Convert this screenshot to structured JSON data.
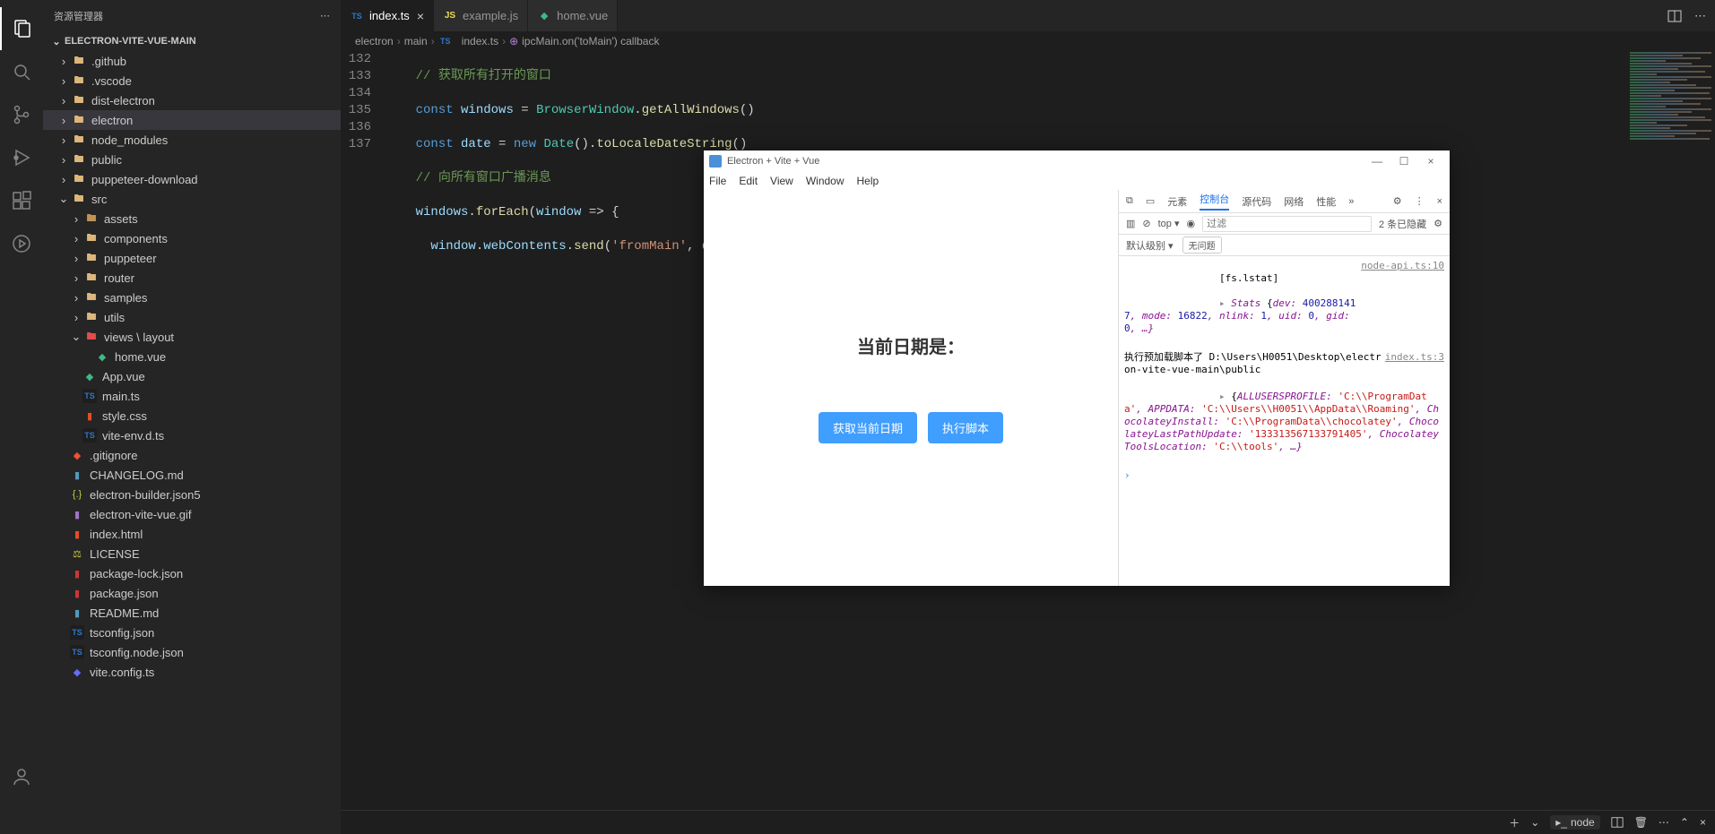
{
  "sidebar": {
    "title": "资源管理器",
    "project": "ELECTRON-VITE-VUE-MAIN"
  },
  "tree": {
    "github": ".github",
    "vscode": ".vscode",
    "dist_electron": "dist-electron",
    "electron": "electron",
    "node_modules": "node_modules",
    "public": "public",
    "puppeteer_download": "puppeteer-download",
    "src": "src",
    "assets": "assets",
    "components": "components",
    "puppeteer": "puppeteer",
    "router": "router",
    "samples": "samples",
    "utils": "utils",
    "views_layout": "views \\ layout",
    "home_vue": "home.vue",
    "app_vue": "App.vue",
    "main_ts": "main.ts",
    "style_css": "style.css",
    "vite_env": "vite-env.d.ts",
    "gitignore": ".gitignore",
    "changelog": "CHANGELOG.md",
    "builder_json5": "electron-builder.json5",
    "vite_vue_gif": "electron-vite-vue.gif",
    "index_html": "index.html",
    "license": "LICENSE",
    "pkg_lock": "package-lock.json",
    "pkg": "package.json",
    "readme": "README.md",
    "tsconfig": "tsconfig.json",
    "tsconfig_node": "tsconfig.node.json",
    "vite_config": "vite.config.ts"
  },
  "tabs": {
    "index_ts": "index.ts",
    "example_js": "example.js",
    "home_vue": "home.vue"
  },
  "breadcrumb": {
    "electron": "electron",
    "main": "main",
    "index_ts": "index.ts",
    "callback": "ipcMain.on('toMain') callback"
  },
  "code": {
    "l132": "132",
    "l133": "133",
    "l134": "134",
    "l135": "135",
    "l136": "136",
    "l137": "137",
    "c132_cmt": "// 获取所有打开的窗口",
    "c135_cmt": "// 向所有窗口广播消息",
    "kw_const": "const",
    "kw_new": "new",
    "var_windows": "windows",
    "var_date": "date",
    "var_window": "window",
    "cls_bw": "BrowserWindow",
    "cls_date": "Date",
    "fn_getall": "getAllWindows",
    "fn_tolocale": "toLocaleDateString",
    "fn_foreach": "forEach",
    "fn_send": "send",
    "prop_wc": "webContents",
    "str_frommain": "'fromMain'",
    "eq": " = ",
    "dot": ".",
    "parens": "()",
    "lparen": "(",
    "rparen": ")",
    "arrow": " => {",
    "comma": ", ",
    "semicol": ""
  },
  "panel": {
    "node": "node"
  },
  "app": {
    "title": "Electron + Vite + Vue",
    "menu": {
      "file": "File",
      "edit": "Edit",
      "view": "View",
      "window": "Window",
      "help": "Help"
    },
    "heading": "当前日期是：",
    "btn_get_date": "获取当前日期",
    "btn_run_script": "执行脚本"
  },
  "devtools": {
    "tabs": {
      "elements": "元素",
      "console": "控制台",
      "sources": "源代码",
      "network": "网络",
      "performance": "性能"
    },
    "filter_placeholder": "过滤",
    "top": "top",
    "hidden_msgs": "2 条已隐藏",
    "default_level": "默认级别",
    "no_issues": "无问题",
    "log1": {
      "tag": "[fs.lstat]",
      "stats_label": "Stats ",
      "stats_open": "{",
      "k_dev": "dev: ",
      "v_dev": "4002881417",
      "k_mode": ", mode: ",
      "v_mode": "16822",
      "k_nlink": ", nlink: ",
      "v_nlink": "1",
      "k_uid": ", uid: ",
      "v_uid": "0",
      "k_gid": ", gid: ",
      "v_gid": "0",
      "rest": ", …}",
      "src": "node-api.ts:10"
    },
    "log2": {
      "text": "执行预加载脚本了 D:\\Users\\H0051\\Desktop\\electron-vite-vue-main\\public",
      "src": "index.ts:3"
    },
    "log3": {
      "open": "{",
      "k1": "ALLUSERSPROFILE: ",
      "v1": "'C:\\\\ProgramData'",
      "k2": ", APPDATA: ",
      "v2": "'C:\\\\Users\\\\H0051\\\\AppData\\\\Roaming'",
      "k3": ", ChocolateyInstall: ",
      "v3": "'C:\\\\ProgramData\\\\chocolatey'",
      "k4": ", ChocolateyLastPathUpdate: ",
      "v4": "'133313567133791405'",
      "k5": ", ChocolateyToolsLocation: ",
      "v5": "'C:\\\\tools'",
      "rest": ", …}"
    }
  }
}
